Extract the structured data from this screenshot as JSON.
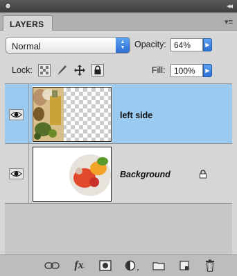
{
  "panel": {
    "tab_label": "LAYERS",
    "blend_mode": "Normal",
    "opacity_label": "Opacity:",
    "opacity_value": "64%",
    "lock_label": "Lock:",
    "fill_label": "Fill:",
    "fill_value": "100%"
  },
  "layers": [
    {
      "name": "left side",
      "visible": true,
      "selected": true,
      "locked": false
    },
    {
      "name": "Background",
      "visible": true,
      "selected": false,
      "locked": true
    }
  ],
  "bottom_toolbar": {
    "fx_label": "fx"
  },
  "colors": {
    "selection": "#9bcaf1",
    "accent_blue": "#2b6fd4",
    "panel_bg": "#d6d6d6"
  }
}
